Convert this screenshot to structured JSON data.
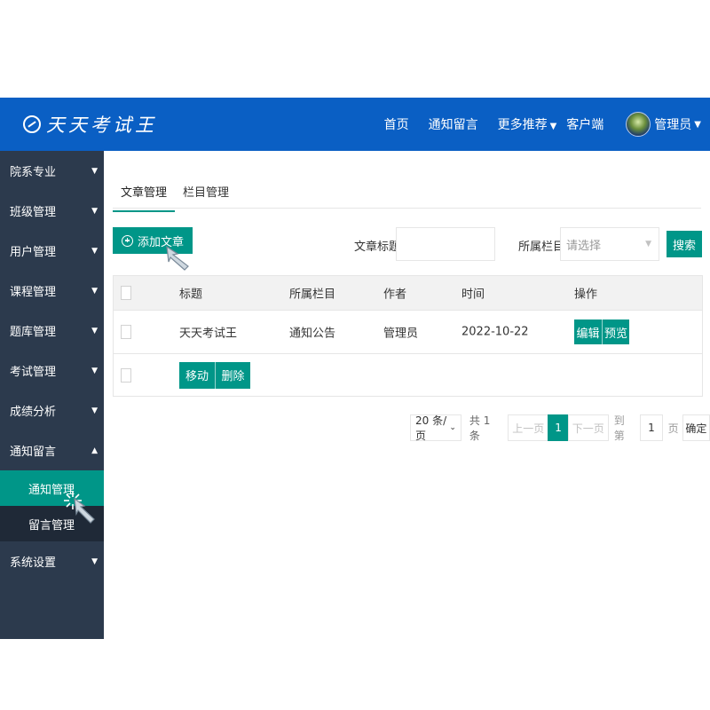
{
  "header": {
    "logo_text": "天天考试王",
    "nav": [
      "首页",
      "通知留言",
      "更多推荐",
      "客户端"
    ],
    "nav_dropdown_index": 2,
    "user": "管理员"
  },
  "sidebar": {
    "items": [
      {
        "label": "院系专业",
        "arrow": "▼"
      },
      {
        "label": "班级管理",
        "arrow": "▼"
      },
      {
        "label": "用户管理",
        "arrow": "▼"
      },
      {
        "label": "课程管理",
        "arrow": "▼"
      },
      {
        "label": "题库管理",
        "arrow": "▼"
      },
      {
        "label": "考试管理",
        "arrow": "▼"
      },
      {
        "label": "成绩分析",
        "arrow": "▼"
      },
      {
        "label": "通知留言",
        "arrow": "▲"
      }
    ],
    "subitems": [
      {
        "label": "通知管理",
        "active": true
      },
      {
        "label": "留言管理",
        "active": false
      }
    ],
    "last_item": {
      "label": "系统设置",
      "arrow": "▼"
    }
  },
  "tabs": [
    {
      "label": "文章管理",
      "active": true
    },
    {
      "label": "栏目管理",
      "active": false
    }
  ],
  "toolbar": {
    "add_label": "添加文章",
    "title_label": "文章标题",
    "title_value": "",
    "column_label": "所属栏目",
    "column_placeholder": "请选择",
    "search_label": "搜索"
  },
  "table": {
    "headers": [
      "标题",
      "所属栏目",
      "作者",
      "时间",
      "操作"
    ],
    "rows": [
      {
        "title": "天天考试王",
        "column": "通知公告",
        "author": "管理员",
        "time": "2022-10-22",
        "actions": [
          "编辑",
          "预览"
        ]
      }
    ],
    "footer_actions": [
      "移动",
      "删除"
    ]
  },
  "pagination": {
    "page_size": "20 条/页",
    "total": "共 1 条",
    "prev": "上一页",
    "current": "1",
    "next": "下一页",
    "goto_label": "到第",
    "goto_value": "1",
    "page_unit": "页",
    "confirm": "确定"
  },
  "colors": {
    "header": "#0a5fc4",
    "sidebar": "#2c3a4d",
    "accent": "#009688"
  }
}
